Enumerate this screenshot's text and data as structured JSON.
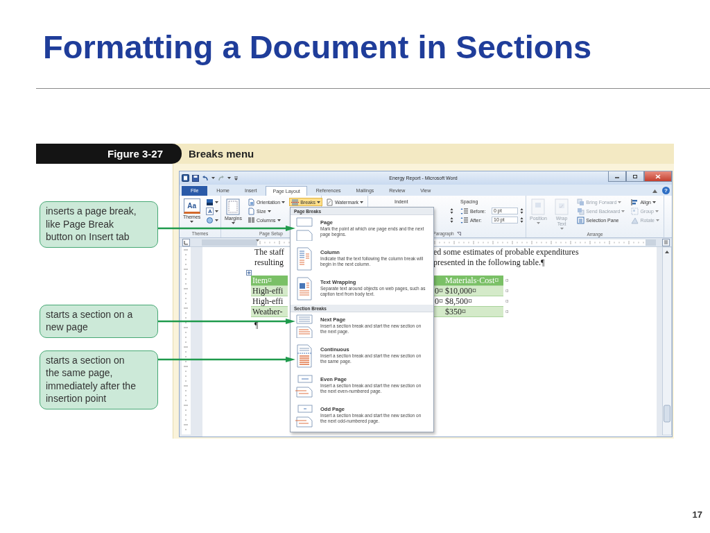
{
  "slide": {
    "title": "Formatting a Document in Sections",
    "page_number": "17"
  },
  "figure": {
    "label": "Figure 3-27",
    "caption": "Breaks menu",
    "callouts": [
      {
        "text": "inserts a page break, like Page Break button on Insert tab"
      },
      {
        "text": "starts a section on a new page"
      },
      {
        "text": "starts a section on the same page, immediately after the insertion point"
      }
    ]
  },
  "word_window": {
    "title": "Energy Report - Microsoft Word",
    "help_button": "?",
    "tabs": [
      {
        "label": "File",
        "kind": "file",
        "selected": false
      },
      {
        "label": "Home",
        "kind": "tab",
        "selected": false
      },
      {
        "label": "Insert",
        "kind": "tab",
        "selected": false
      },
      {
        "label": "Page Layout",
        "kind": "tab",
        "selected": true
      },
      {
        "label": "References",
        "kind": "tab",
        "selected": false
      },
      {
        "label": "Mailings",
        "kind": "tab",
        "selected": false
      },
      {
        "label": "Review",
        "kind": "tab",
        "selected": false
      },
      {
        "label": "View",
        "kind": "tab",
        "selected": false
      }
    ],
    "ribbon": [
      {
        "kind": "themes",
        "label": "Themes",
        "columns": [
          [
            {
              "kind": "large",
              "label": "Themes",
              "glyph": "Aa",
              "dropdown": true
            }
          ],
          [
            {
              "kind": "icon",
              "dropdown": true
            },
            {
              "kind": "icon",
              "glyph": "A",
              "dropdown": true
            },
            {
              "kind": "icon",
              "dropdown": true
            }
          ]
        ]
      },
      {
        "kind": "page_setup",
        "label": "Page Setup",
        "columns": [
          [
            {
              "kind": "large",
              "label": "Margins",
              "dropdown": true,
              "active": false
            }
          ],
          [
            {
              "kind": "small",
              "label": "Orientation",
              "dropdown": true,
              "active": false
            },
            {
              "kind": "small",
              "label": "Size",
              "dropdown": true,
              "active": false
            },
            {
              "kind": "small",
              "label": "Columns",
              "dropdown": true,
              "active": false
            }
          ],
          [
            {
              "kind": "small",
              "label": "Breaks",
              "dropdown": true,
              "active": true
            }
          ]
        ]
      },
      {
        "kind": "page_background",
        "columns": [
          [
            {
              "kind": "small",
              "label": "Watermark",
              "dropdown": true
            }
          ]
        ]
      },
      {
        "kind": "paragraph",
        "label": "Paragraph",
        "launcher": true,
        "columns": [
          [
            {
              "kind": "heading",
              "label": "Indent"
            },
            {
              "kind": "spinner"
            },
            {
              "kind": "spinner"
            }
          ],
          [
            {
              "kind": "heading",
              "label": "Spacing"
            },
            {
              "kind": "field",
              "label": "Before:",
              "value": "0 pt"
            },
            {
              "kind": "field",
              "label": "After:",
              "value": "10 pt"
            }
          ]
        ]
      },
      {
        "kind": "arrange",
        "label": "Arrange",
        "columns": [
          [
            {
              "kind": "large",
              "label": "Position",
              "dropdown": true,
              "disabled": true
            }
          ],
          [
            {
              "kind": "large",
              "label": "Wrap Text",
              "dropdown": true,
              "disabled": true
            }
          ],
          [
            {
              "kind": "small",
              "label": "Bring Forward",
              "dropdown": true,
              "disabled": true
            },
            {
              "kind": "small",
              "label": "Send Backward",
              "dropdown": true,
              "disabled": true
            },
            {
              "kind": "small",
              "label": "Selection Pane",
              "disabled": false
            }
          ],
          [
            {
              "kind": "small",
              "label": "Align",
              "dropdown": true,
              "disabled": false
            },
            {
              "kind": "small",
              "label": "Group",
              "dropdown": true,
              "disabled": true
            },
            {
              "kind": "small",
              "label": "Rotate",
              "dropdown": true,
              "disabled": true
            }
          ]
        ]
      }
    ],
    "document": {
      "lines": [
        {
          "left": "The staff",
          "right": "ed some estimates of probable expenditures"
        },
        {
          "left": "resulting",
          "right": "presented in the following table.¶"
        }
      ],
      "table": {
        "header": {
          "column_1": "Item¤",
          "column_3": "Materials·Cost¤",
          "end_mark": "¤"
        },
        "rows": [
          {
            "column_1": "High-effi",
            "column_2": "0¤",
            "column_3": "$10,000¤",
            "end_mark": "¤"
          },
          {
            "column_1": "High-effi",
            "column_2": "0¤",
            "column_3": "$8,500¤",
            "end_mark": "¤"
          },
          {
            "column_1": "Weather-",
            "column_3": "$350¤",
            "end_mark": "¤"
          }
        ]
      },
      "paragraph_mark": "¶"
    }
  },
  "breaks_menu": {
    "sections": [
      {
        "heading": "Page Breaks",
        "items": [
          {
            "kind": "page",
            "title": "Page",
            "description": "Mark the point at which one page ends and the next page begins."
          },
          {
            "kind": "column",
            "title": "Column",
            "description": "Indicate that the text following the column break will begin in the next column."
          },
          {
            "kind": "text_wrapping",
            "title": "Text Wrapping",
            "description": "Separate text around objects on web pages, such as caption text from body text."
          }
        ]
      },
      {
        "heading": "Section Breaks",
        "items": [
          {
            "kind": "next_page",
            "title": "Next Page",
            "description": "Insert a section break and start the new section on the next page."
          },
          {
            "kind": "continuous",
            "title": "Continuous",
            "description": "Insert a section break and start the new section on the same page."
          },
          {
            "kind": "even_page",
            "title": "Even Page",
            "description": "Insert a section break and start the new section on the next even-numbered page."
          },
          {
            "kind": "odd_page",
            "title": "Odd Page",
            "description": "Insert a section break and start the new section on the next odd-numbered page."
          }
        ]
      }
    ]
  }
}
